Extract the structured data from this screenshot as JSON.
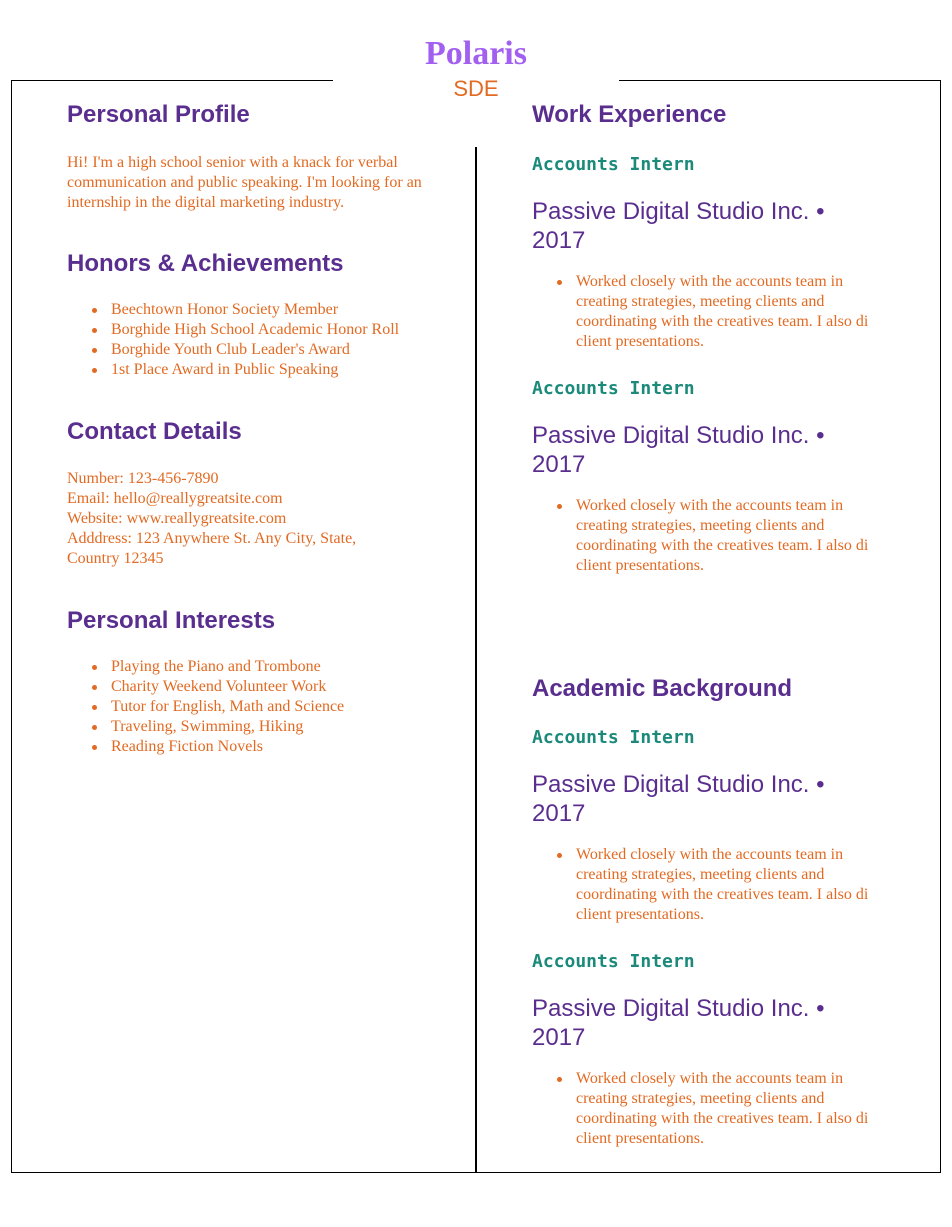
{
  "header": {
    "name": "Polaris",
    "role": "SDE"
  },
  "left": {
    "profile": {
      "heading": "Personal Profile",
      "text": "Hi! I'm a high school senior with a knack for verbal communication and public speaking. I'm looking for an internship in the digital marketing industry."
    },
    "honors": {
      "heading": "Honors & Achievements",
      "items": [
        "Beechtown Honor Society Member",
        "Borghide High School Academic Honor Roll",
        "Borghide Youth Club Leader's Award",
        "1st Place Award in Public Speaking"
      ]
    },
    "contact": {
      "heading": "Contact Details",
      "lines": [
        "Number: 123-456-7890",
        "Email: hello@reallygreatsite.com",
        "Website: www.reallygreatsite.com",
        "Adddress: 123 Anywhere St. Any City, State, Country 12345"
      ]
    },
    "interests": {
      "heading": "Personal Interests",
      "items": [
        "Playing the Piano and Trombone",
        "Charity Weekend Volunteer Work",
        "Tutor for English, Math and Science",
        "Traveling, Swimming, Hiking",
        "Reading Fiction Novels"
      ]
    }
  },
  "right": {
    "work": {
      "heading": "Work Experience",
      "entries": [
        {
          "title": "Accounts Intern",
          "company": "Passive Digital Studio Inc. • 2017",
          "bullet": "Worked closely with the accounts team in creating strategies, meeting clients and coordinating with the creatives team. I also di client presentations."
        },
        {
          "title": "Accounts Intern",
          "company": "Passive Digital Studio Inc. • 2017",
          "bullet": "Worked closely with the accounts team in creating strategies, meeting clients and coordinating with the creatives team. I also di client presentations."
        }
      ]
    },
    "academic": {
      "heading": "Academic Background",
      "entries": [
        {
          "title": "Accounts Intern",
          "company": "Passive Digital Studio Inc. • 2017",
          "bullet": "Worked closely with the accounts team in creating strategies, meeting clients and coordinating with the creatives team. I also di client presentations."
        },
        {
          "title": "Accounts Intern",
          "company": "Passive Digital Studio Inc. • 2017",
          "bullet": "Worked closely with the accounts team in creating strategies, meeting clients and coordinating with the creatives team. I also di client presentations."
        }
      ]
    }
  }
}
